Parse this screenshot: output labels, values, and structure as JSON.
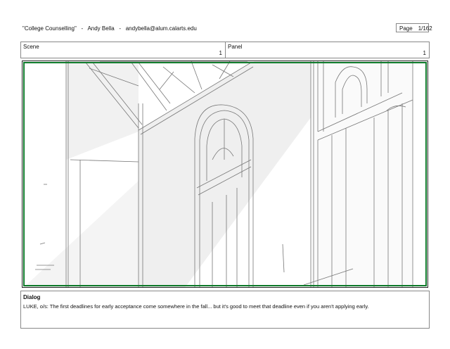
{
  "header": {
    "title": "\"College Counselling\"",
    "sep1": "-",
    "author": "Andy Bella",
    "sep2": "-",
    "email": "andybella@alum.calarts.edu"
  },
  "page": {
    "label": "Page",
    "value": "1/162"
  },
  "scene": {
    "label": "Scene",
    "value": "1"
  },
  "panel": {
    "label": "Panel",
    "value": "1"
  },
  "frame": {
    "border_color": "#0e7a2a",
    "image": "storyboard-sketch-church-windows"
  },
  "dialog": {
    "label": "Dialog",
    "text": "LUKE, o/s: The first deadlines for early acceptance come somewhere in the fall... but it's good to meet that deadline even if you aren't applying early."
  }
}
